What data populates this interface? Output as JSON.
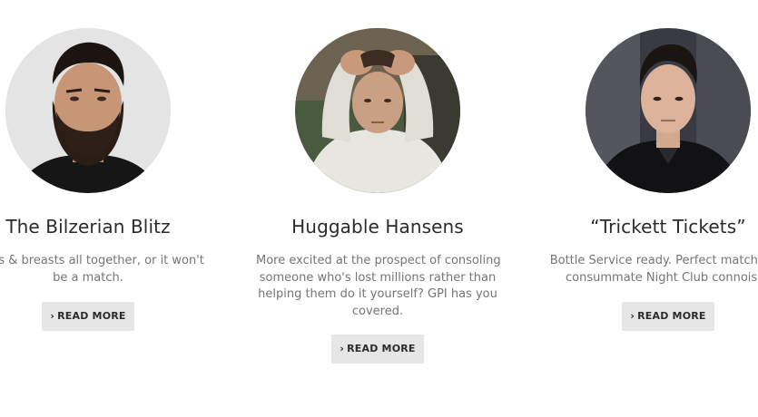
{
  "cards": [
    {
      "name": "The Bilzerian Blitz",
      "description_lines": [
        "boats & breasts all together, or it won't",
        "be a match."
      ],
      "button_label": "READ MORE"
    },
    {
      "name": "Huggable Hansens",
      "description_lines": [
        "More excited at the prospect of consoling",
        "someone who's lost millions rather than",
        "helping them do it yourself? GPI has you",
        "covered."
      ],
      "button_label": "READ MORE"
    },
    {
      "name": "“Trickett Tickets”",
      "description_lines": [
        "Bottle Service ready. Perfect matches fo",
        "consummate Night Club connoisse"
      ],
      "button_label": "READ MORE"
    }
  ],
  "icons": {
    "button_prefix": "chevron-right-icon"
  },
  "colors": {
    "button_bg": "#e6e6e6",
    "heading": "#2b2b2b",
    "body_text": "#757575"
  }
}
